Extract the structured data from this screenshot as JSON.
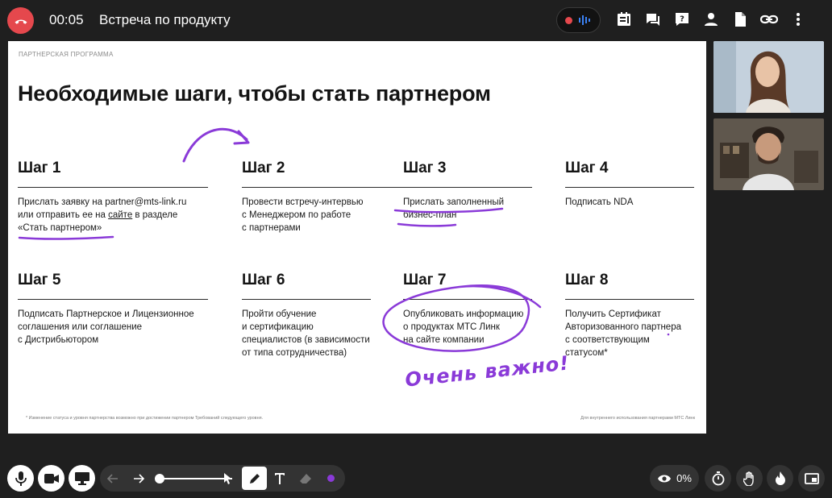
{
  "header": {
    "timer": "00:05",
    "title": "Встреча по продукту"
  },
  "slide": {
    "eyebrow": "ПАРТНЕРСКАЯ ПРОГРАММА",
    "title": "Необходимые шаги, чтобы стать партнером",
    "steps": [
      {
        "head": "Шаг 1",
        "lines": [
          "Прислать заявку на partner@mts-link.ru",
          "или отправить ее на ",
          "сайте",
          " в разделе",
          "«Стать партнером»"
        ]
      },
      {
        "head": "Шаг 2",
        "lines": [
          "Провести встречу-интервью",
          "с Менеджером по работе",
          "с партнерами"
        ]
      },
      {
        "head": "Шаг 3",
        "lines": [
          "Прислать заполненный",
          "бизнес-план"
        ]
      },
      {
        "head": "Шаг 4",
        "lines": [
          "Подписать NDA"
        ]
      },
      {
        "head": "Шаг 5",
        "lines": [
          "Подписать Партнерское и Лицензионное",
          "соглашения или соглашение",
          "с Дистрибьютором"
        ]
      },
      {
        "head": "Шаг 6",
        "lines": [
          "Пройти обучение",
          "и сертификацию",
          "специалистов (в зависимости",
          "от типа сотрудничества)"
        ]
      },
      {
        "head": "Шаг 7",
        "lines": [
          "Опубликовать информацию",
          "о продуктах МТС Линк",
          "на сайте компании"
        ]
      },
      {
        "head": "Шаг 8",
        "lines": [
          "Получить Сертификат",
          "Авторизованного партнера",
          "с соответствующим",
          "статусом*"
        ]
      }
    ],
    "footnote_left": "* Изменение статуса и уровня партнерства возможно при достижении партнером Требований следующего уровня.",
    "footnote_right": "Для внутреннего использования партнерами МТС Линк",
    "handwriting": "Очень важно!"
  },
  "bottom": {
    "views": "0%"
  },
  "colors": {
    "end_call": "#e5484d",
    "annotation": "#8a3ad8",
    "rec_wave": "#3b82f6"
  }
}
